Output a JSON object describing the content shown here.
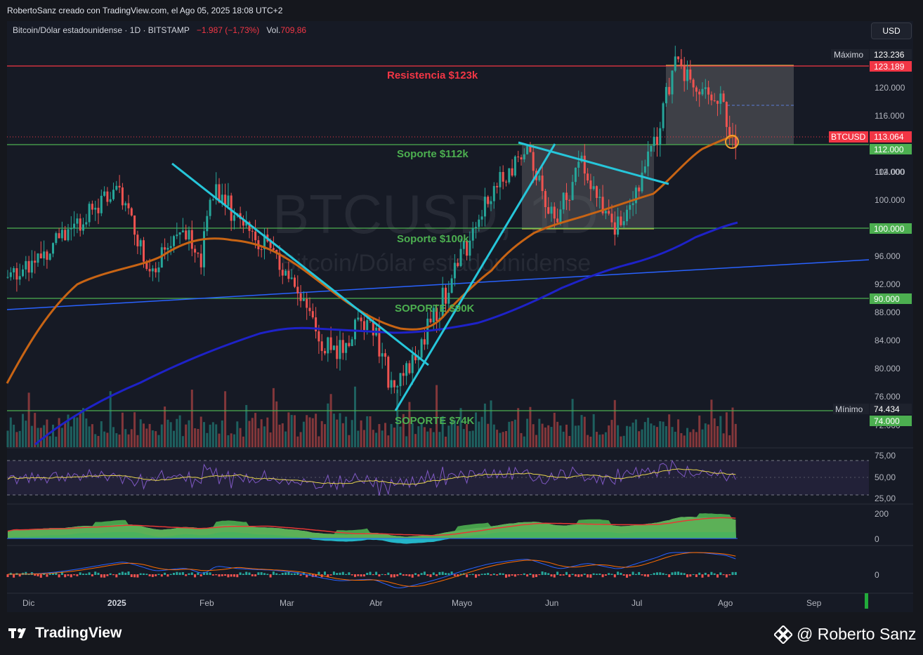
{
  "header": {
    "created_by": "RobertoSanz creado con TradingView.com, el Ago 05, 2025 18:08 UTC+2",
    "symbol_desc": "Bitcoin/Dólar estadounidense · 1D · BITSTAMP",
    "change": "−1.987 (−1,73%)",
    "vol_label": "Vol.",
    "vol_value": "709,86",
    "currency": "USD"
  },
  "watermark": {
    "line1": "BTCUSD, 1D",
    "line2": "Bitcoin/Dólar estadounidense"
  },
  "annotations": {
    "resistance_123": "Resistencia $123k",
    "support_112": "Soporte $112k",
    "support_100": "Soporte $100k",
    "support_90": "SOPORTE $90K",
    "support_74": "SOPORTE $74K"
  },
  "price_labels": {
    "max_label": "Máximo",
    "max_value": "123.236",
    "res_value": "123.189",
    "last_label": "BTCUSD",
    "last_value": "113.064",
    "sup112_value": "112.000",
    "sup100_value": "100.000",
    "sup90_value": "90.000",
    "min_label": "Mínimo",
    "min_value": "74.434",
    "sup74_value": "74.000"
  },
  "footer": {
    "brand": "TradingView",
    "author": "@ Roberto Sanz"
  },
  "colors": {
    "background": "#161a25",
    "up": "#26a69a",
    "down": "#ef5350",
    "resistance": "#f23645",
    "support": "#4caf50",
    "trendline": "#26c6da",
    "ema50": "#c86414",
    "ema200": "#1e22c8",
    "longtrend": "#2962ff",
    "rsi": "#7e57c2"
  },
  "chart_data": [
    {
      "type": "line",
      "title": "",
      "xlabel": "",
      "ylabel": "",
      "x_ticks": [
        "Dic",
        "2025",
        "Feb",
        "Mar",
        "Abr",
        "Mayo",
        "Jun",
        "Jul",
        "Ago",
        "Sep"
      ],
      "y_ticks": [
        "72.000",
        "76.000",
        "80.000",
        "84.000",
        "88.000",
        "92.000",
        "96.000",
        "100.000",
        "104.000",
        "108.000",
        "112.000",
        "116.000",
        "120.000"
      ],
      "ylim": [
        70000,
        126000
      ],
      "series": [
        {
          "name": "BTCUSD",
          "x": [
            "Nov 25",
            "Dic 5",
            "Dic 17",
            "Dic 25",
            "Ene 6",
            "Ene 13",
            "Ene 20",
            "Ene 31",
            "Feb 10",
            "Feb 24",
            "Mar 3",
            "Mar 10",
            "Mar 25",
            "Abr 7",
            "Abr 21",
            "May 1",
            "May 10",
            "May 22",
            "Jun 5",
            "Jun 10",
            "Jun 22",
            "Jul 1",
            "Jul 10",
            "Jul 14",
            "Jul 22",
            "Jul 30",
            "Ago 2",
            "Ago 5"
          ],
          "values": [
            93000,
            97000,
            106000,
            94000,
            101000,
            94000,
            106000,
            102000,
            97500,
            91500,
            86000,
            82000,
            87500,
            76500,
            87500,
            94500,
            103000,
            111500,
            101000,
            109500,
            99000,
            107000,
            111500,
            123000,
            119000,
            118000,
            113500,
            113064
          ]
        }
      ],
      "horizontal_levels": [
        123189,
        112000,
        100000,
        90000,
        74000
      ],
      "range_box_jun": [
        100000,
        112000
      ],
      "range_box_jul": [
        112000,
        123236
      ],
      "last_price": 113064,
      "high": 123236,
      "low": 74434,
      "grid": false
    },
    {
      "type": "line",
      "title": "",
      "y_ticks": [
        "75,00",
        "50,00",
        "25,00"
      ],
      "ylim": [
        20,
        80
      ],
      "levels": [
        70,
        30
      ]
    },
    {
      "type": "area",
      "title": "",
      "y_ticks": [
        "200",
        "0"
      ]
    },
    {
      "type": "bar",
      "title": "",
      "y_ticks": [
        "0"
      ]
    }
  ]
}
